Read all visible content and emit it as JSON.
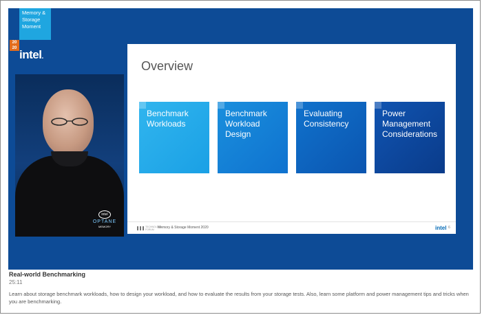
{
  "event": {
    "name_lines": [
      "Memory &",
      "Storage",
      "Moment"
    ],
    "year_lines": [
      "20",
      "20"
    ],
    "brand": "intel"
  },
  "presenter": {
    "shirt_brand": "intel",
    "shirt_product": "OPTANE",
    "shirt_subtext": "MEMORY"
  },
  "slide": {
    "title": "Overview",
    "tiles": [
      {
        "label": "Benchmark\nWorkloads",
        "color": "#1aa0e5"
      },
      {
        "label": "Benchmark\nWorkload\nDesign",
        "color": "#0f72cf"
      },
      {
        "label": "Evaluating\nConsistency",
        "color": "#0b55b0"
      },
      {
        "label": "Power\nManagement\nConsiderations",
        "color": "#0a3b8a"
      }
    ],
    "footer_tag": "TECHNOLOGY FORUM",
    "footer_event": "Memory & Storage Moment 2020",
    "footer_brand": "intel",
    "page_number": "6"
  },
  "video_info": {
    "title": "Real-world Benchmarking",
    "duration": "25:11",
    "description": "Learn about storage benchmark workloads, how to design your workload, and how to evaluate the results from your storage tests. Also, learn some platform and power management tips and tricks when you are benchmarking."
  },
  "colors": {
    "video_background": "#0d4b96",
    "event_badge": "#1fa6e0",
    "year_badge": "#e36c1c"
  }
}
